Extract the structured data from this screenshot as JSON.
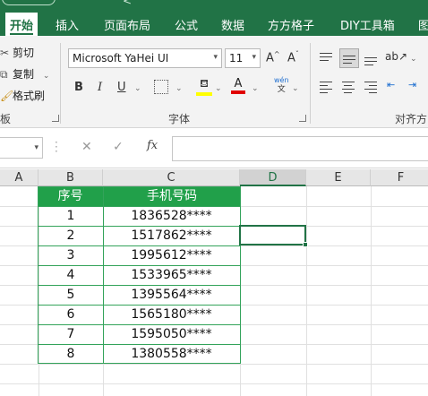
{
  "tabs": [
    {
      "label": "开始",
      "active": true
    },
    {
      "label": "插入"
    },
    {
      "label": "页面布局"
    },
    {
      "label": "公式"
    },
    {
      "label": "数据"
    },
    {
      "label": "方方格子"
    },
    {
      "label": "DIY工具箱"
    },
    {
      "label": "图"
    }
  ],
  "clipboard": {
    "cut": "剪切",
    "copy": "复制",
    "format_painter": "格式刷",
    "group_label": "板"
  },
  "font": {
    "family": "Microsoft YaHei UI",
    "size": "11",
    "grow": "A^",
    "shrink": "Aˇ",
    "bold": "B",
    "italic": "I",
    "underline": "U",
    "pinyin_top": "wén",
    "pinyin_bottom": "文",
    "group_label": "字体",
    "highlight_color": "#ffff00",
    "font_color": "#e00000"
  },
  "alignment": {
    "group_label": "对齐方"
  },
  "formula_bar": {
    "fx": "fx",
    "content": ""
  },
  "columns": [
    {
      "label": "A"
    },
    {
      "label": "B"
    },
    {
      "label": "C"
    },
    {
      "label": "D",
      "selected": true
    },
    {
      "label": "E"
    },
    {
      "label": "F"
    }
  ],
  "table": {
    "headers": [
      "序号",
      "手机号码"
    ],
    "rows": [
      [
        "1",
        "1836528****"
      ],
      [
        "2",
        "1517862****"
      ],
      [
        "3",
        "1995612****"
      ],
      [
        "4",
        "1533965****"
      ],
      [
        "5",
        "1395564****"
      ],
      [
        "6",
        "1565180****"
      ],
      [
        "7",
        "1595050****"
      ],
      [
        "8",
        "1380558****"
      ]
    ]
  },
  "colors": {
    "accent": "#217346",
    "table_header": "#21a04a",
    "table_border": "#33a35a"
  }
}
